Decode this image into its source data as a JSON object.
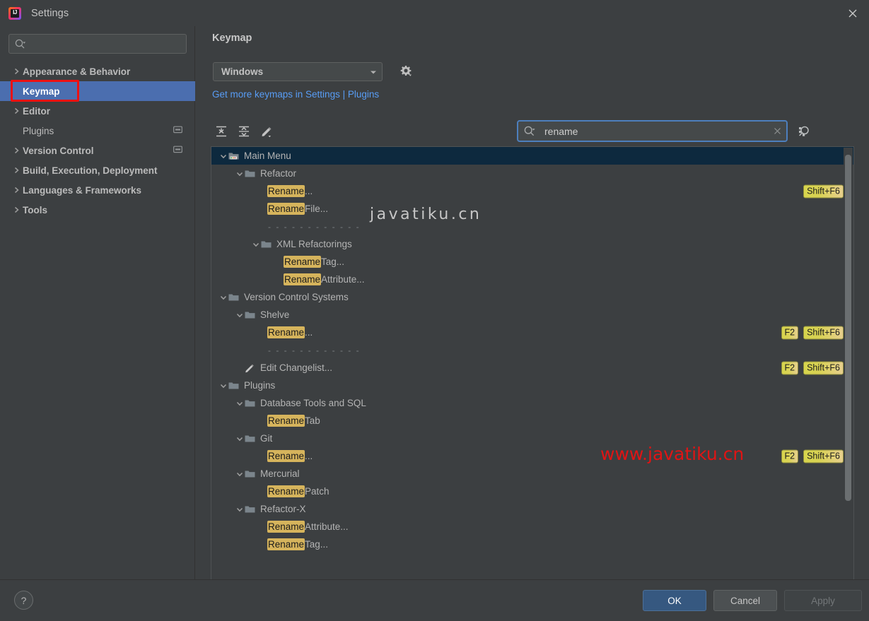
{
  "window": {
    "title": "Settings",
    "logo_glyph": "IJ",
    "close_icon": "close-icon"
  },
  "sidebar": {
    "search": {
      "value": "",
      "placeholder": "",
      "icon": "search-icon"
    },
    "items": [
      {
        "label": "Appearance & Behavior",
        "expandable": true,
        "selected": false,
        "trailing": null
      },
      {
        "label": "Keymap",
        "expandable": false,
        "selected": true,
        "trailing": null
      },
      {
        "label": "Editor",
        "expandable": true,
        "selected": false,
        "trailing": null
      },
      {
        "label": "Plugins",
        "expandable": false,
        "selected": false,
        "trailing": "project-scope-icon"
      },
      {
        "label": "Version Control",
        "expandable": true,
        "selected": false,
        "trailing": "project-scope-icon"
      },
      {
        "label": "Build, Execution, Deployment",
        "expandable": true,
        "selected": false,
        "trailing": null
      },
      {
        "label": "Languages & Frameworks",
        "expandable": true,
        "selected": false,
        "trailing": null
      },
      {
        "label": "Tools",
        "expandable": true,
        "selected": false,
        "trailing": null
      }
    ]
  },
  "main": {
    "page_title": "Keymap",
    "keymap_select": {
      "value": "Windows",
      "options": [
        "Windows"
      ]
    },
    "gear_label": "gear-icon",
    "link_text": "Get more keymaps in Settings | Plugins",
    "toolbar": [
      {
        "name": "expand-all-icon",
        "tooltip": "Expand All"
      },
      {
        "name": "collapse-all-icon",
        "tooltip": "Collapse All"
      },
      {
        "name": "edit-shortcut-icon",
        "tooltip": "Edit Shortcut"
      }
    ],
    "find": {
      "value": "rename",
      "placeholder": "",
      "search_icon": "search-icon",
      "clear_icon": "clear-icon"
    },
    "shortcut_find_label": "find-by-shortcut-icon"
  },
  "tree": [
    {
      "indent": 0,
      "twisty": "down",
      "icon": "main-menu-icon",
      "selected": true,
      "segments": [
        {
          "t": "Main Menu",
          "hl": false
        }
      ],
      "shortcuts": []
    },
    {
      "indent": 1,
      "twisty": "down",
      "icon": "folder-icon",
      "selected": false,
      "segments": [
        {
          "t": "Refactor",
          "hl": false
        }
      ],
      "shortcuts": []
    },
    {
      "indent": 2,
      "twisty": "none",
      "icon": "none",
      "selected": false,
      "segments": [
        {
          "t": "Rename",
          "hl": true
        },
        {
          "t": "...",
          "hl": false
        }
      ],
      "shortcuts": [
        "Shift+F6"
      ]
    },
    {
      "indent": 2,
      "twisty": "none",
      "icon": "none",
      "selected": false,
      "segments": [
        {
          "t": "Rename",
          "hl": true
        },
        {
          "t": " File...",
          "hl": false
        }
      ],
      "shortcuts": []
    },
    {
      "indent": 2,
      "twisty": "none",
      "icon": "none",
      "selected": false,
      "separator": true,
      "segments": [],
      "shortcuts": []
    },
    {
      "indent": 2,
      "twisty": "down",
      "icon": "folder-icon",
      "selected": false,
      "segments": [
        {
          "t": "XML Refactorings",
          "hl": false
        }
      ],
      "shortcuts": []
    },
    {
      "indent": 3,
      "twisty": "none",
      "icon": "none",
      "selected": false,
      "segments": [
        {
          "t": "Rename",
          "hl": true
        },
        {
          "t": " Tag...",
          "hl": false
        }
      ],
      "shortcuts": []
    },
    {
      "indent": 3,
      "twisty": "none",
      "icon": "none",
      "selected": false,
      "segments": [
        {
          "t": "Rename",
          "hl": true
        },
        {
          "t": " Attribute...",
          "hl": false
        }
      ],
      "shortcuts": []
    },
    {
      "indent": 0,
      "twisty": "down",
      "icon": "folder-icon",
      "selected": false,
      "segments": [
        {
          "t": "Version Control Systems",
          "hl": false
        }
      ],
      "shortcuts": []
    },
    {
      "indent": 1,
      "twisty": "down",
      "icon": "folder-icon",
      "selected": false,
      "segments": [
        {
          "t": "Shelve",
          "hl": false
        }
      ],
      "shortcuts": []
    },
    {
      "indent": 2,
      "twisty": "none",
      "icon": "none",
      "selected": false,
      "segments": [
        {
          "t": "Rename",
          "hl": true
        },
        {
          "t": "...",
          "hl": false
        }
      ],
      "shortcuts": [
        "F2",
        "Shift+F6"
      ]
    },
    {
      "indent": 2,
      "twisty": "none",
      "icon": "none",
      "selected": false,
      "separator": true,
      "segments": [],
      "shortcuts": []
    },
    {
      "indent": 1,
      "twisty": "none",
      "icon": "pencil-icon",
      "selected": false,
      "segments": [
        {
          "t": "Edit Changelist...",
          "hl": false
        }
      ],
      "shortcuts": [
        "F2",
        "Shift+F6"
      ]
    },
    {
      "indent": 0,
      "twisty": "down",
      "icon": "folder-icon",
      "selected": false,
      "segments": [
        {
          "t": "Plugins",
          "hl": false
        }
      ],
      "shortcuts": []
    },
    {
      "indent": 1,
      "twisty": "down",
      "icon": "folder-icon",
      "selected": false,
      "segments": [
        {
          "t": "Database Tools and SQL",
          "hl": false
        }
      ],
      "shortcuts": []
    },
    {
      "indent": 2,
      "twisty": "none",
      "icon": "none",
      "selected": false,
      "segments": [
        {
          "t": "Rename",
          "hl": true
        },
        {
          "t": " Tab",
          "hl": false
        }
      ],
      "shortcuts": []
    },
    {
      "indent": 1,
      "twisty": "down",
      "icon": "folder-icon",
      "selected": false,
      "segments": [
        {
          "t": "Git",
          "hl": false
        }
      ],
      "shortcuts": []
    },
    {
      "indent": 2,
      "twisty": "none",
      "icon": "none",
      "selected": false,
      "segments": [
        {
          "t": "Rename",
          "hl": true
        },
        {
          "t": "...",
          "hl": false
        }
      ],
      "shortcuts": [
        "F2",
        "Shift+F6"
      ]
    },
    {
      "indent": 1,
      "twisty": "down",
      "icon": "folder-icon",
      "selected": false,
      "segments": [
        {
          "t": "Mercurial",
          "hl": false
        }
      ],
      "shortcuts": []
    },
    {
      "indent": 2,
      "twisty": "none",
      "icon": "none",
      "selected": false,
      "segments": [
        {
          "t": "Rename",
          "hl": true
        },
        {
          "t": " Patch",
          "hl": false
        }
      ],
      "shortcuts": []
    },
    {
      "indent": 1,
      "twisty": "down",
      "icon": "folder-icon",
      "selected": false,
      "segments": [
        {
          "t": "Refactor-X",
          "hl": false
        }
      ],
      "shortcuts": []
    },
    {
      "indent": 2,
      "twisty": "none",
      "icon": "none",
      "selected": false,
      "segments": [
        {
          "t": "Rename",
          "hl": true
        },
        {
          "t": " Attribute...",
          "hl": false
        }
      ],
      "shortcuts": []
    },
    {
      "indent": 2,
      "twisty": "none",
      "icon": "none",
      "selected": false,
      "segments": [
        {
          "t": "Rename",
          "hl": true
        },
        {
          "t": " Tag...",
          "hl": false
        }
      ],
      "shortcuts": []
    }
  ],
  "watermarks": {
    "grey": "javatiku.cn",
    "red": "www.javatiku.cn"
  },
  "footer": {
    "help_label": "?",
    "ok_label": "OK",
    "cancel_label": "Cancel",
    "apply_label": "Apply"
  },
  "colors": {
    "window_bg": "#3c3f41",
    "selection_blue": "#4b6eaf",
    "tree_selection": "#0d293e",
    "link_blue": "#589df6",
    "highlight_gold": "#d6b45c",
    "kbd_yellow": "#d7d54d",
    "primary_button": "#365880",
    "annotation_red": "#ee1111",
    "watermark_red": "#e01414"
  }
}
